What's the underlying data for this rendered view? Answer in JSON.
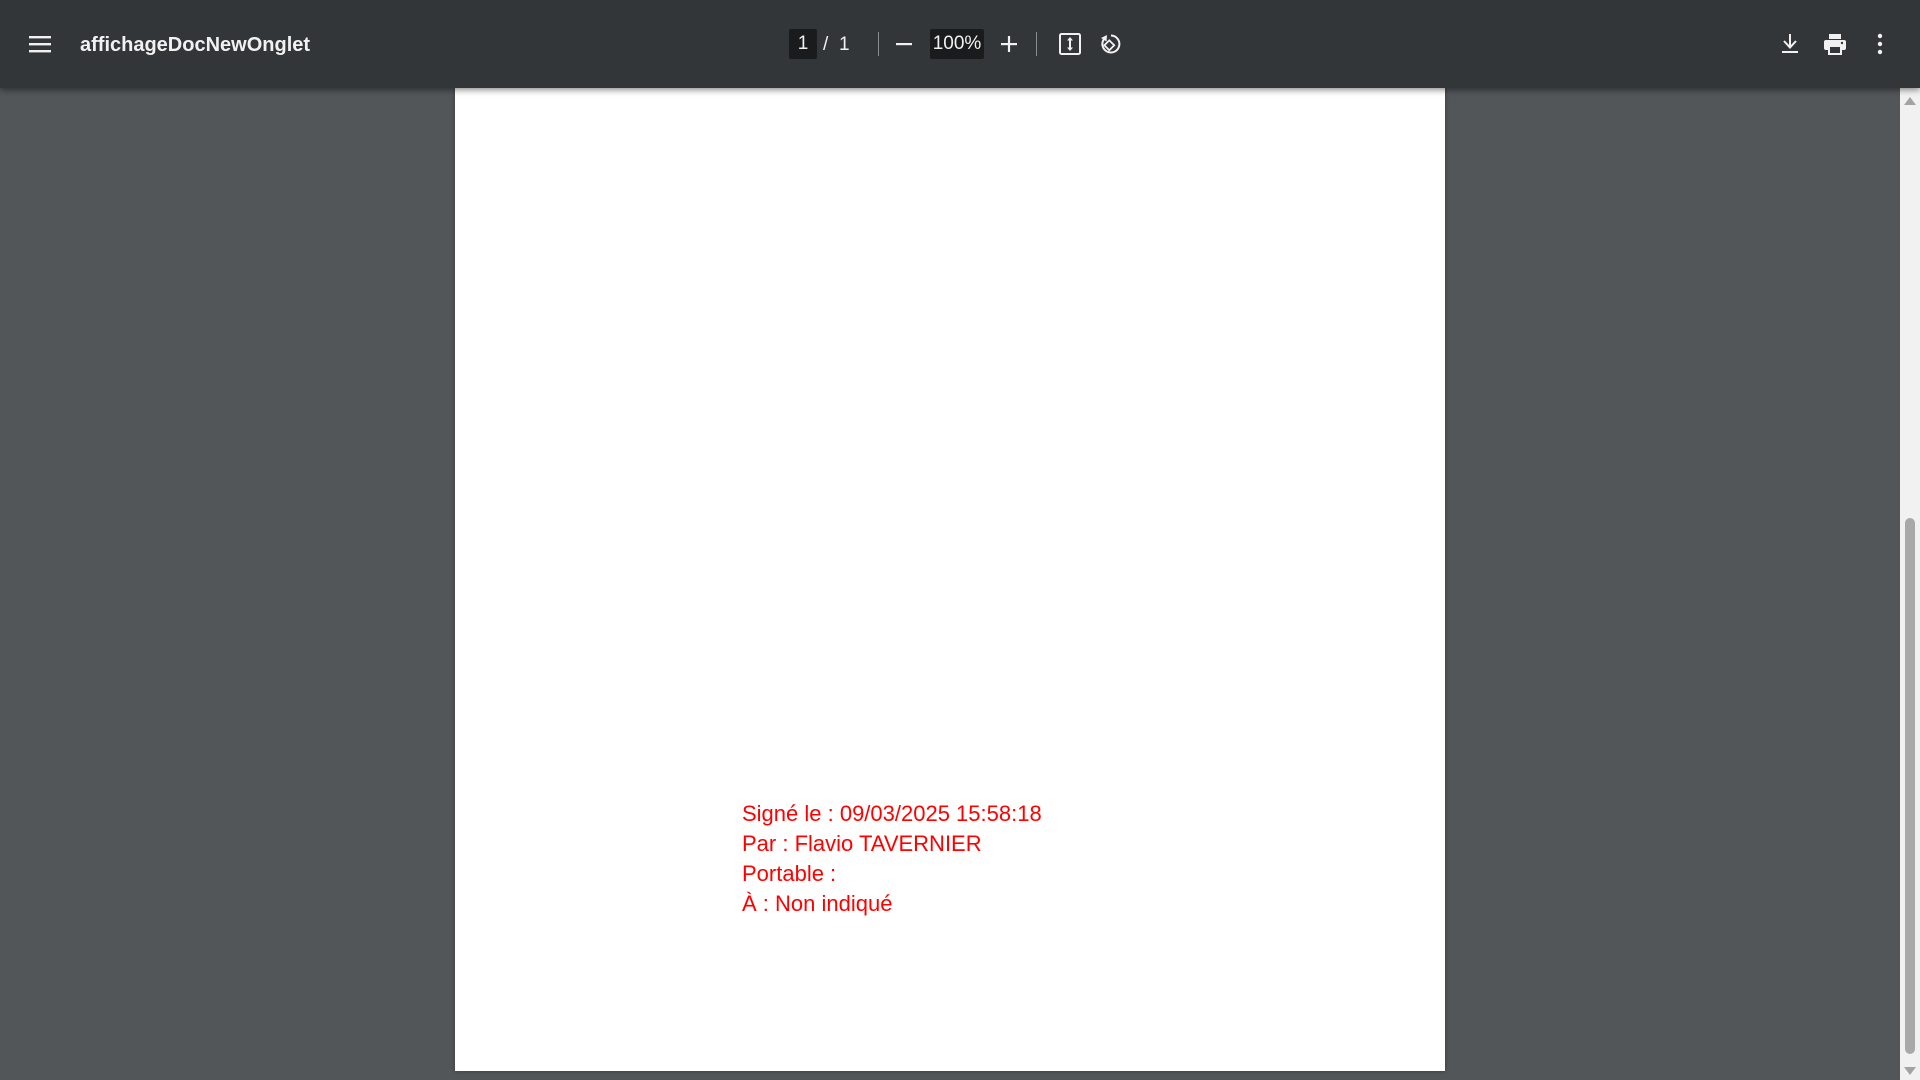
{
  "toolbar": {
    "title": "affichageDocNewOnglet",
    "current_page": "1",
    "page_separator": "/",
    "total_pages": "1",
    "zoom": "100%",
    "icons": {
      "menu": "menu-icon",
      "zoom_out": "minus-icon",
      "zoom_in": "plus-icon",
      "fit": "fit-to-page-icon",
      "rotate": "rotate-icon",
      "download": "download-icon",
      "print": "print-icon",
      "more": "more-vertical-icon"
    }
  },
  "document": {
    "signature": {
      "signed_line": "Signé le : 09/03/2025 15:58:18",
      "by_line": "Par : Flavio TAVERNIER",
      "mobile_line": "Portable :",
      "to_line": "À : Non indiqué",
      "color": "#ff0000"
    }
  },
  "colors": {
    "toolbar_bg": "#323639",
    "viewer_bg": "#525659",
    "page_bg": "#ffffff"
  }
}
